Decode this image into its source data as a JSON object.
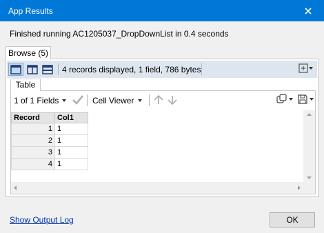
{
  "window": {
    "title": "App Results"
  },
  "status_message": "Finished running AC1205037_DropDownList in 0.4 seconds",
  "browse_tab": {
    "label": "Browse (5)"
  },
  "toolbar": {
    "records_info": "4 records displayed, 1 field, 786 bytes",
    "layouts": [
      "single-pane-layout",
      "side-by-side-layout",
      "top-bottom-layout"
    ]
  },
  "table_tab": {
    "label": "Table"
  },
  "table_toolbar": {
    "fields_selector": "1 of 1 Fields",
    "viewer_selector": "Cell Viewer"
  },
  "grid": {
    "columns": [
      "Record",
      "Col1"
    ],
    "rows": [
      {
        "record": "1",
        "col1": "1"
      },
      {
        "record": "2",
        "col1": "1"
      },
      {
        "record": "3",
        "col1": "1"
      },
      {
        "record": "4",
        "col1": "1"
      }
    ]
  },
  "footer": {
    "output_log_label": "Show Output Log",
    "ok_label": "OK"
  },
  "colors": {
    "titlebar": "#0078d7",
    "link": "#0033aa"
  }
}
